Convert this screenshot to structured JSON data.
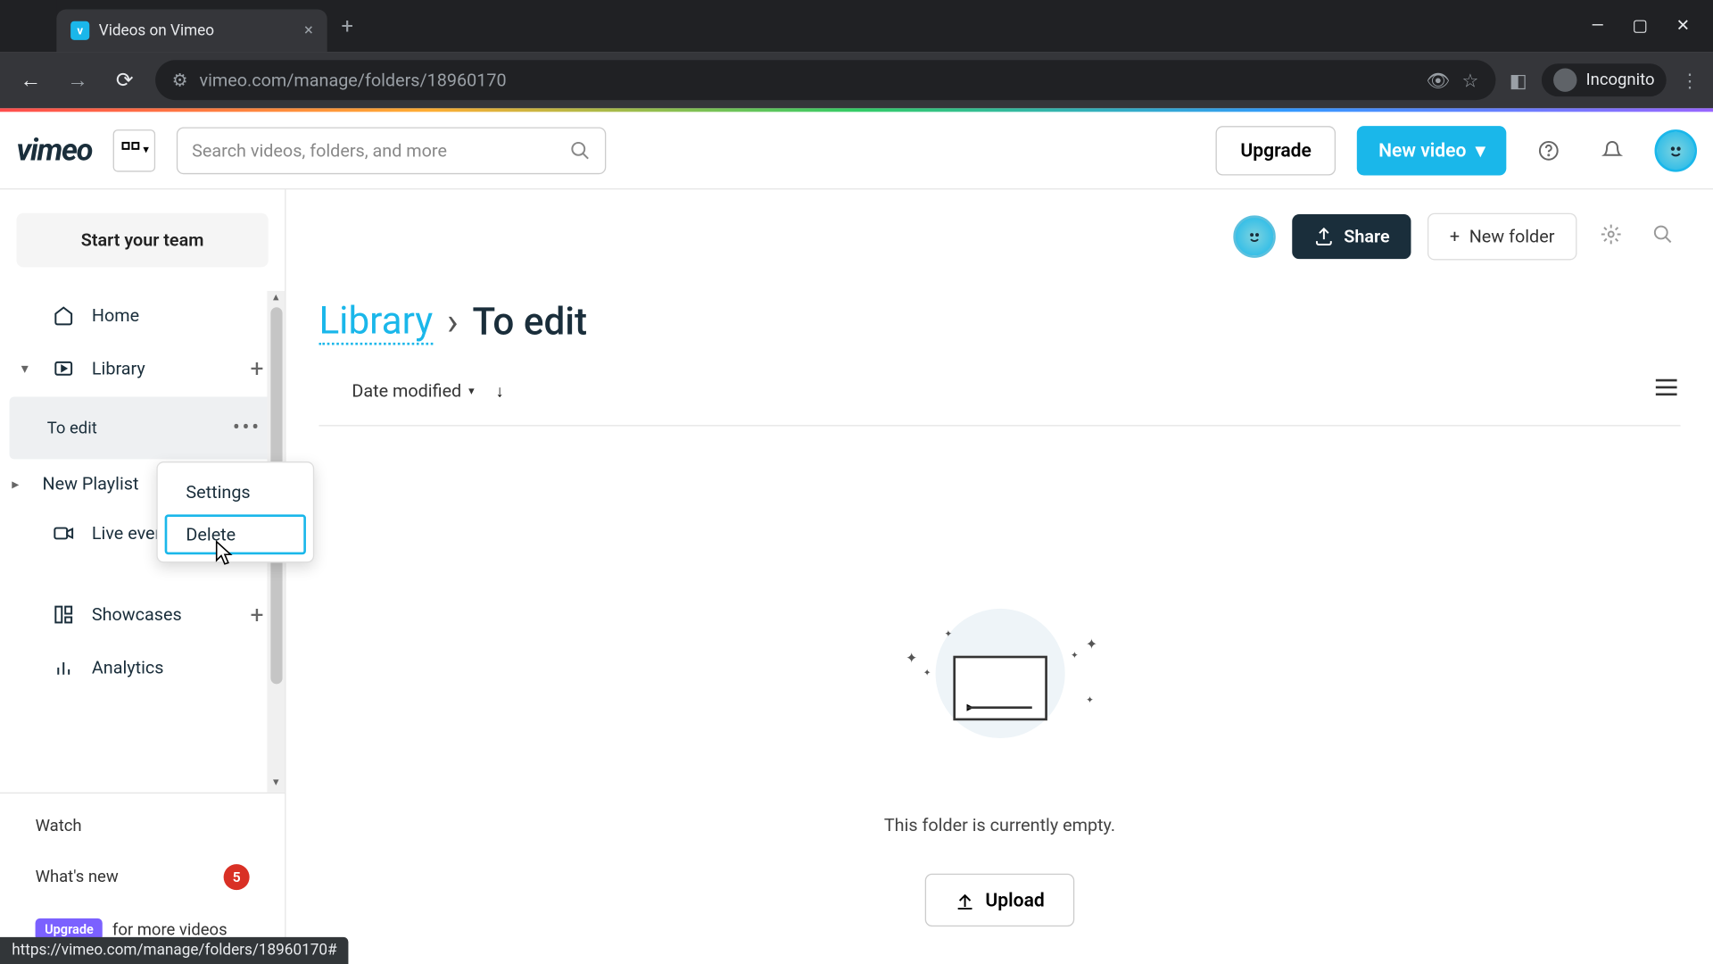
{
  "browser": {
    "tab_title": "Videos on Vimeo",
    "url": "vimeo.com/manage/folders/18960170",
    "incognito_label": "Incognito",
    "status_bar": "https://vimeo.com/manage/folders/18960170#"
  },
  "header": {
    "logo": "vimeo",
    "search_placeholder": "Search videos, folders, and more",
    "upgrade_label": "Upgrade",
    "new_video_label": "New video"
  },
  "sidebar": {
    "start_team": "Start your team",
    "home": "Home",
    "library": "Library",
    "library_sub": {
      "to_edit": "To edit",
      "new_playlist": "New Playlist"
    },
    "live_events": "Live events",
    "showcases": "Showcases",
    "analytics": "Analytics",
    "watch": "Watch",
    "whats_new": "What's new",
    "whats_new_count": "5",
    "upgrade_pill": "Upgrade",
    "upgrade_text": "for more videos"
  },
  "context_menu": {
    "settings": "Settings",
    "delete": "Delete"
  },
  "content": {
    "share_label": "Share",
    "new_folder_label": "New folder",
    "breadcrumb_library": "Library",
    "breadcrumb_sep": "›",
    "breadcrumb_current": "To edit",
    "sort_label": "Date modified",
    "empty_text": "This folder is currently empty.",
    "upload_label": "Upload"
  }
}
